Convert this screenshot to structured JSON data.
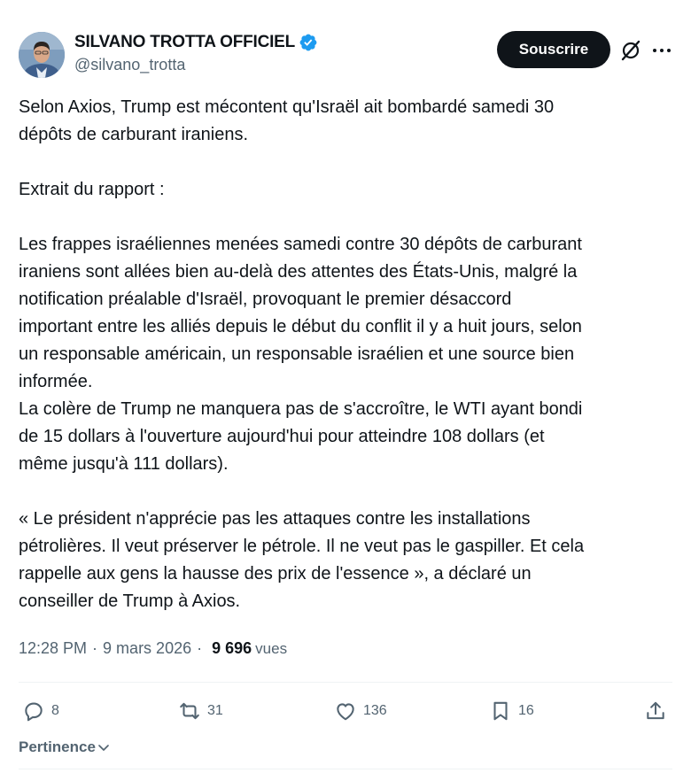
{
  "author": {
    "name": "SILVANO TROTTA OFFICIEL",
    "handle": "@silvano_trotta",
    "verified_color": "#1d9bf0"
  },
  "header": {
    "subscribe_label": "Souscrire",
    "grok_icon": "grok-icon",
    "more_icon": "more-icon"
  },
  "tweet": {
    "text": "Selon Axios, Trump est mécontent qu'Israël ait bombardé samedi 30\ndépôts de carburant iraniens.\n\nExtrait du rapport :\n\nLes frappes israéliennes menées samedi contre 30 dépôts de carburant\niraniens sont allées bien au-delà des attentes des États-Unis, malgré la\nnotification préalable d'Israël, provoquant le premier désaccord\nimportant entre les alliés depuis le début du conflit il y a huit jours, selon\nun responsable américain, un responsable israélien et une source bien\ninformée.\nLa colère de Trump ne manquera pas de s'accroître, le WTI ayant bondi\nde 15 dollars à l'ouverture aujourd'hui pour atteindre 108 dollars (et\nmême jusqu'à 111 dollars).\n\n« Le président n'apprécie pas les attaques contre les installations\npétrolières. Il veut préserver le pétrole. Il ne veut pas le gaspiller. Et cela\nrappelle aux gens la hausse des prix de l'essence », a déclaré un\nconseiller de Trump à Axios."
  },
  "meta": {
    "time": "12:28 PM",
    "date": "9 mars 2026",
    "separator": "·",
    "views_count": "9 696",
    "views_label": "vues"
  },
  "actions": {
    "replies": "8",
    "reposts": "31",
    "likes": "136",
    "bookmarks": "16"
  },
  "sort": {
    "label": "Pertinence"
  }
}
